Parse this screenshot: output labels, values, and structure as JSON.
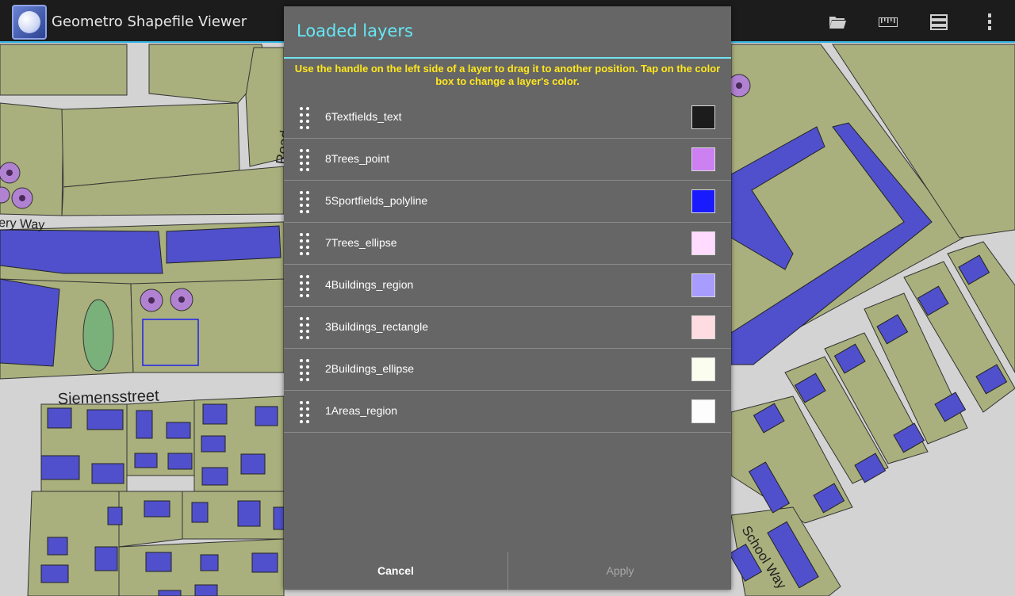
{
  "app": {
    "title": "Geometro Shapefile Viewer",
    "icon": "globe-icon"
  },
  "toolbar": {
    "actions": [
      {
        "icon": "folder-open-icon"
      },
      {
        "icon": "ruler-icon"
      },
      {
        "icon": "layers-icon"
      },
      {
        "icon": "overflow-menu-icon"
      }
    ]
  },
  "map": {
    "street_labels": [
      "ery Way",
      "Siemensstreet",
      "School Way",
      "Road"
    ],
    "colors": {
      "background": "#d3d3d3",
      "area": "#a9b07d",
      "building": "#5050cc",
      "tree": "#b182d2",
      "sportfield": "#7ab07a",
      "sportfield_line": "#2020ee"
    }
  },
  "dialog": {
    "title": "Loaded layers",
    "hint": "Use the handle on the left side of a layer to drag it to another position. Tap on the color box to change a layer's color.",
    "layers": [
      {
        "name": "6Textfields_text",
        "color": "#1c1c1c"
      },
      {
        "name": "8Trees_point",
        "color": "#cc80f2"
      },
      {
        "name": "5Sportfields_polyline",
        "color": "#1a1aff"
      },
      {
        "name": "7Trees_ellipse",
        "color": "#ffdcff"
      },
      {
        "name": "4Buildings_region",
        "color": "#a89cff"
      },
      {
        "name": "3Buildings_rectangle",
        "color": "#ffdce2"
      },
      {
        "name": "2Buildings_ellipse",
        "color": "#fbfdee"
      },
      {
        "name": "1Areas_region",
        "color": "#fdfdfd"
      }
    ],
    "cancel_label": "Cancel",
    "apply_label": "Apply",
    "apply_enabled": false
  }
}
